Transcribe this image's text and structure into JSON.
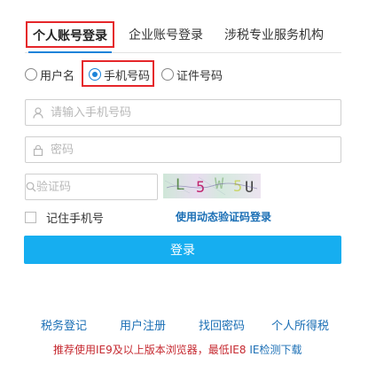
{
  "tabs": [
    {
      "label": "个人账号登录",
      "active": true
    },
    {
      "label": "企业账号登录",
      "active": false
    },
    {
      "label": "涉税专业服务机构",
      "active": false
    }
  ],
  "login_type": {
    "options": [
      "用户名",
      "手机号码",
      "证件号码"
    ],
    "selected": "手机号码"
  },
  "form": {
    "phone_placeholder": "请输入手机号码",
    "password_placeholder": "密码",
    "captcha_placeholder": "验证码",
    "captcha_chars": [
      "L",
      "5",
      "W",
      "5",
      "U"
    ]
  },
  "remember_label": "记住手机号",
  "dynamic_code_link": "使用动态验证码登录",
  "login_button": "登录",
  "footer_links": [
    "税务登记",
    "用户注册",
    "找回密码",
    "个人所得税"
  ],
  "notice": {
    "text": "推荐使用IE9及以上版本浏览器，最低IE8",
    "link": "IE检测下载"
  },
  "colors": {
    "accent": "#1b83d9",
    "button": "#16aef0",
    "highlight": "#e5262a",
    "notice": "#c5282f"
  }
}
